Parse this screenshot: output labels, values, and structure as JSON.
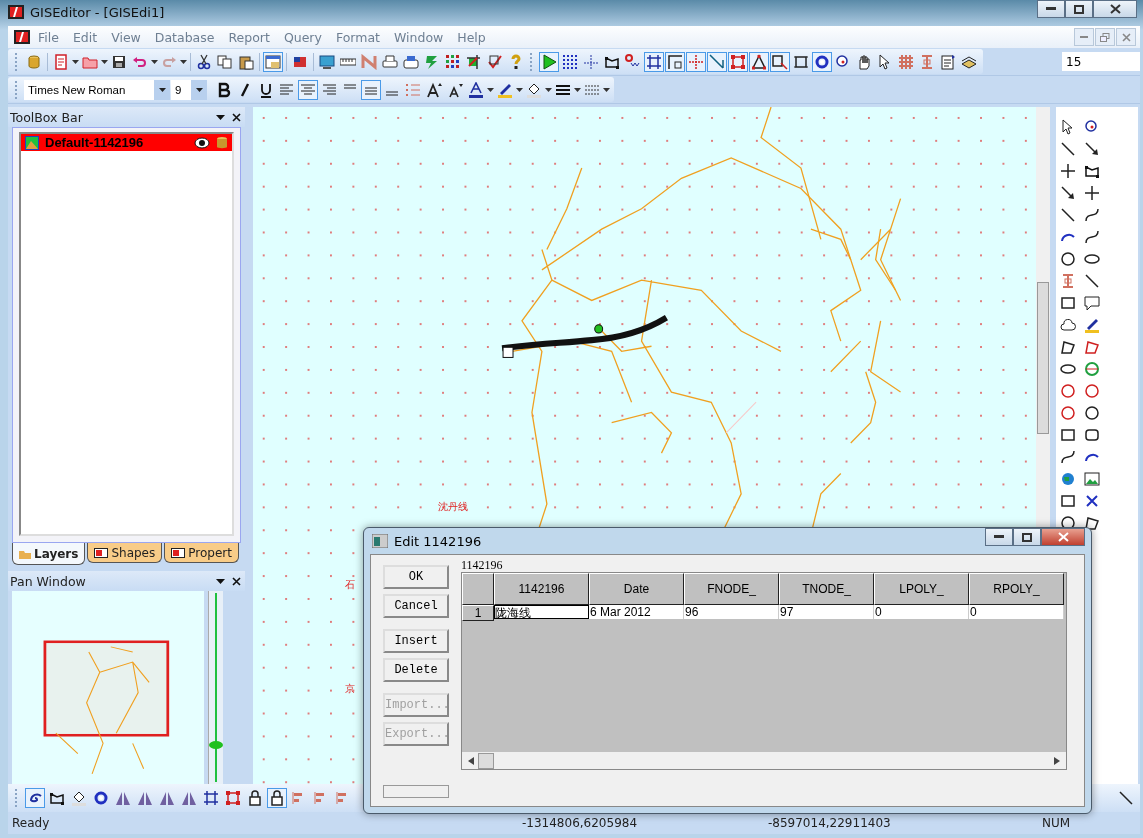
{
  "window": {
    "title": "GISEditor - [GISEdi1]"
  },
  "menu": [
    "File",
    "Edit",
    "View",
    "Database",
    "Report",
    "Query",
    "Format",
    "Window",
    "Help"
  ],
  "format_bar": {
    "font": "Times New Roman",
    "size": "9"
  },
  "align_tools": [
    {
      "pressed": false
    },
    {
      "pressed": true
    },
    {
      "pressed": false
    },
    {
      "pressed": false
    },
    {
      "pressed": true
    },
    {
      "pressed": false
    }
  ],
  "draw_tools": [
    {
      "pressed": true
    },
    {
      "pressed": false
    },
    {
      "pressed": false
    },
    {
      "pressed": false
    },
    {
      "pressed": false
    },
    {
      "pressed": true
    },
    {
      "pressed": true
    },
    {
      "pressed": true
    },
    {
      "pressed": true
    },
    {
      "pressed": true
    },
    {
      "pressed": true
    },
    {
      "pressed": true
    },
    {
      "pressed": false
    },
    {
      "pressed": true
    },
    {
      "pressed": false
    },
    {
      "pressed": false
    },
    {
      "pressed": false
    },
    {
      "pressed": false
    },
    {
      "pressed": false
    },
    {
      "pressed": false
    },
    {
      "pressed": false
    }
  ],
  "scale_field": {
    "value": "15"
  },
  "toolbox": {
    "title": "ToolBox Bar",
    "layers": [
      {
        "name": "Default-1142196",
        "selected": true
      }
    ],
    "tabs": [
      {
        "label": "Layers",
        "selected": true
      },
      {
        "label": "Shapes",
        "selected": false
      },
      {
        "label": "Propert",
        "selected": false
      }
    ]
  },
  "pan_window": {
    "title": "Pan Window",
    "zoom": {
      "level": 0.2
    }
  },
  "map": {
    "labels": [
      "沈丹线",
      "石",
      "京"
    ]
  },
  "bottom_tools": [
    {
      "pressed": true
    },
    {
      "pressed": false
    },
    {
      "pressed": false
    },
    {
      "pressed": false
    },
    {
      "pressed": false
    },
    {
      "pressed": false
    },
    {
      "pressed": false
    },
    {
      "pressed": false
    },
    {
      "pressed": false
    },
    {
      "pressed": false
    },
    {
      "pressed": false
    },
    {
      "pressed": true
    },
    {
      "pressed": false
    },
    {
      "pressed": false
    },
    {
      "pressed": false
    }
  ],
  "dialog": {
    "title": "Edit 1142196",
    "buttons": [
      {
        "label": "OK",
        "disabled": false
      },
      {
        "label": "Cancel",
        "disabled": false
      },
      {
        "label": "Insert",
        "disabled": false
      },
      {
        "label": "Delete",
        "disabled": false
      },
      {
        "label": "Import...",
        "disabled": true
      },
      {
        "label": "Export...",
        "disabled": true
      }
    ],
    "table_caption": "1142196",
    "columns": [
      "1142196",
      "Date",
      "FNODE_",
      "TNODE_",
      "LPOLY_",
      "RPOLY_"
    ],
    "rows": [
      {
        "number": "1",
        "cells": [
          "陇海线",
          "6 Mar 2012",
          "96",
          "97",
          "0",
          "0"
        ]
      }
    ],
    "progress": {
      "level": 0
    }
  },
  "status_bar": [
    "Ready",
    "-1314806,6205984",
    "-8597014,22911403",
    "NUM"
  ]
}
